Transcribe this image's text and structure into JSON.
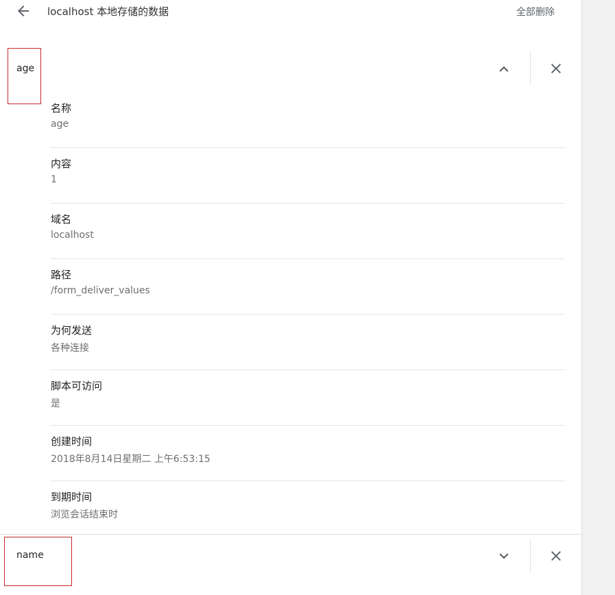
{
  "header": {
    "title": "localhost 本地存储的数据",
    "remove_all_label": "全部删除"
  },
  "cookies": [
    {
      "name": "age",
      "expanded": true,
      "fields": [
        {
          "label": "名称",
          "value": "age"
        },
        {
          "label": "内容",
          "value": "1"
        },
        {
          "label": "域名",
          "value": "localhost"
        },
        {
          "label": "路径",
          "value": "/form_deliver_values"
        },
        {
          "label": "为何发送",
          "value": "各种连接"
        },
        {
          "label": "脚本可访问",
          "value": "是"
        },
        {
          "label": "创建时间",
          "value": "2018年8月14日星期二 上午6:53:15"
        },
        {
          "label": "到期时间",
          "value": "浏览会话结束时"
        }
      ]
    },
    {
      "name": "name",
      "expanded": false
    }
  ],
  "colors": {
    "highlight_border": "#c62828",
    "icon": "#5f6368",
    "value_text": "#6e6e6e"
  },
  "icons": {
    "back": "arrow-back-icon",
    "collapse": "chevron-up-icon",
    "expand": "chevron-down-icon",
    "remove": "close-icon"
  }
}
